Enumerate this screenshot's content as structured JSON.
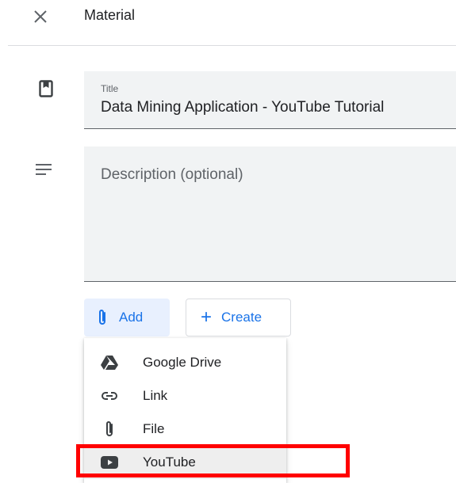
{
  "header": {
    "title": "Material",
    "close_icon": "close-icon"
  },
  "title_field": {
    "icon": "bookmark-icon",
    "label": "Title",
    "value": "Data Mining Application - YouTube Tutorial"
  },
  "description_field": {
    "icon": "notes-icon",
    "placeholder": "Description (optional)",
    "value": ""
  },
  "actions": {
    "add_label": "Add",
    "add_icon": "paperclip-icon",
    "create_label": "Create",
    "create_icon": "plus-icon"
  },
  "add_menu": {
    "items": [
      {
        "label": "Google Drive",
        "icon": "google-drive-icon"
      },
      {
        "label": "Link",
        "icon": "link-icon"
      },
      {
        "label": "File",
        "icon": "paperclip-icon"
      },
      {
        "label": "YouTube",
        "icon": "youtube-icon",
        "highlighted": true
      }
    ]
  },
  "colors": {
    "accent": "#1a73e8",
    "field_background": "#f1f3f4",
    "add_button_background": "#e8f0fe",
    "highlight": "#ff0000"
  }
}
